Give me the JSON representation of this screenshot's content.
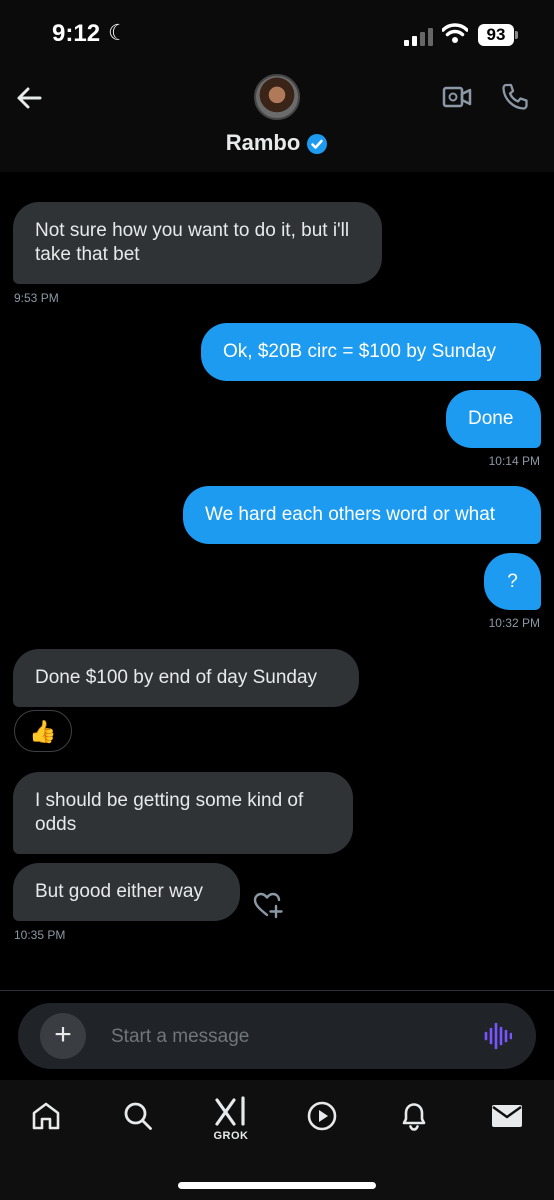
{
  "status_bar": {
    "time": "9:12",
    "battery": "93"
  },
  "header": {
    "contact_name": "Rambo"
  },
  "messages": [
    {
      "direction": "in",
      "text": "Not sure how you want to do it, but i'll take that bet",
      "timestamp": "9:53 PM"
    },
    {
      "direction": "out",
      "text": "Ok, $20B circ = $100 by Sunday"
    },
    {
      "direction": "out",
      "text": "Done",
      "timestamp": "10:14 PM"
    },
    {
      "direction": "out",
      "text": "We hard each others word or what"
    },
    {
      "direction": "out",
      "text": "?",
      "timestamp": "10:32 PM"
    },
    {
      "direction": "in",
      "text": "Done $100 by end of day Sunday",
      "reaction": "👍"
    },
    {
      "direction": "in",
      "text": "I should be getting some kind of odds"
    },
    {
      "direction": "in",
      "text": "But good either way",
      "timestamp": "10:35 PM"
    }
  ],
  "composer": {
    "placeholder": "Start a message"
  },
  "bottom_nav": {
    "items": [
      {
        "icon": "home-icon"
      },
      {
        "icon": "search-icon"
      },
      {
        "icon": "grok-icon",
        "label": "GROK"
      },
      {
        "icon": "play-icon"
      },
      {
        "icon": "bell-icon"
      },
      {
        "icon": "mail-icon"
      }
    ]
  },
  "colors": {
    "outgoing": "#1d9bf0",
    "incoming": "#2f3336",
    "background": "#000000",
    "verified": "#1d9bf0",
    "voice": "#7856ff"
  }
}
